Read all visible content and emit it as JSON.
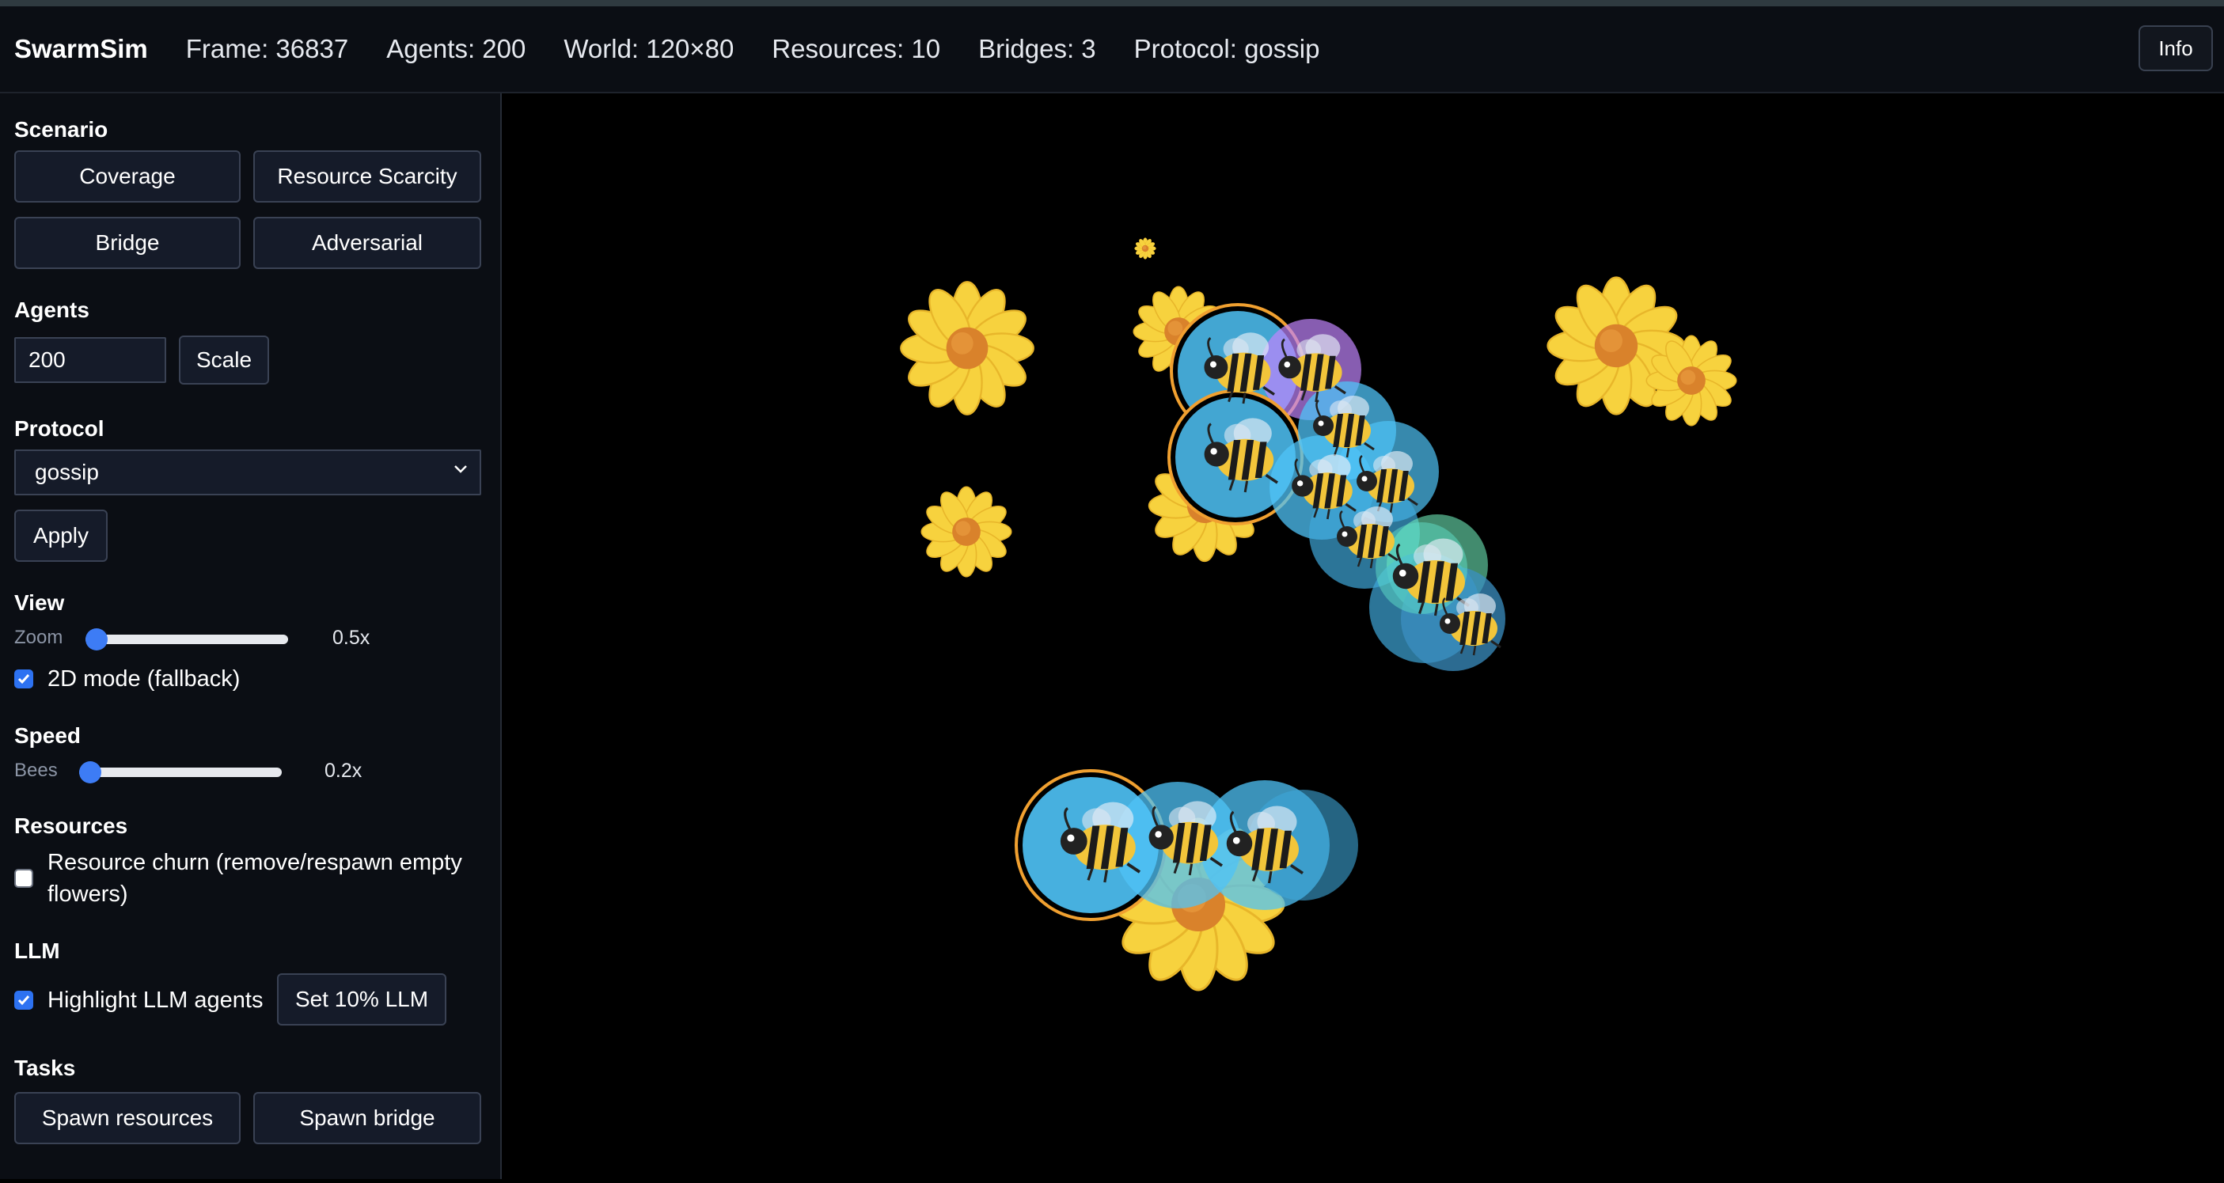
{
  "header": {
    "app_title": "SwarmSim",
    "frame": "Frame: 36837",
    "agents": "Agents: 200",
    "world": "World: 120×80",
    "resources": "Resources: 10",
    "bridges": "Bridges: 3",
    "protocol": "Protocol: gossip",
    "info_label": "Info"
  },
  "sidebar": {
    "scenario": {
      "title": "Scenario",
      "buttons": [
        "Coverage",
        "Resource Scarcity",
        "Bridge",
        "Adversarial"
      ]
    },
    "agents": {
      "title": "Agents",
      "count_value": "200",
      "scale_label": "Scale"
    },
    "protocol": {
      "title": "Protocol",
      "selected": "gossip",
      "apply_label": "Apply"
    },
    "view": {
      "title": "View",
      "zoom_label": "Zoom",
      "zoom_value": "0.5x",
      "zoom_fraction": 0.0,
      "mode_2d_label": "2D mode (fallback)",
      "mode_2d_checked": true
    },
    "speed": {
      "title": "Speed",
      "bees_label": "Bees",
      "bees_value": "0.2x",
      "bees_fraction": 0.0
    },
    "resources": {
      "title": "Resources",
      "churn_label_line1": "Resource churn (remove/respawn empty",
      "churn_label_line2": "flowers)",
      "churn_checked": false
    },
    "llm": {
      "title": "LLM",
      "highlight_label": "Highlight LLM agents",
      "highlight_checked": true,
      "set_llm_label": "Set 10% LLM"
    },
    "tasks": {
      "title": "Tasks",
      "spawn_resources_label": "Spawn resources",
      "spawn_bridge_label": "Spawn bridge"
    }
  },
  "world": {
    "icons": [
      "bee-icon",
      "flower-icon"
    ],
    "colors": {
      "background": "#000000",
      "bee_bubble": "#4fc3f7",
      "llm_bubble": "#c084fc",
      "gossip_bubble": "#6ee7b7",
      "llm_ring": "#f0a030",
      "flower_petal": "#f7d23e",
      "flower_center": "#d9822b"
    }
  }
}
